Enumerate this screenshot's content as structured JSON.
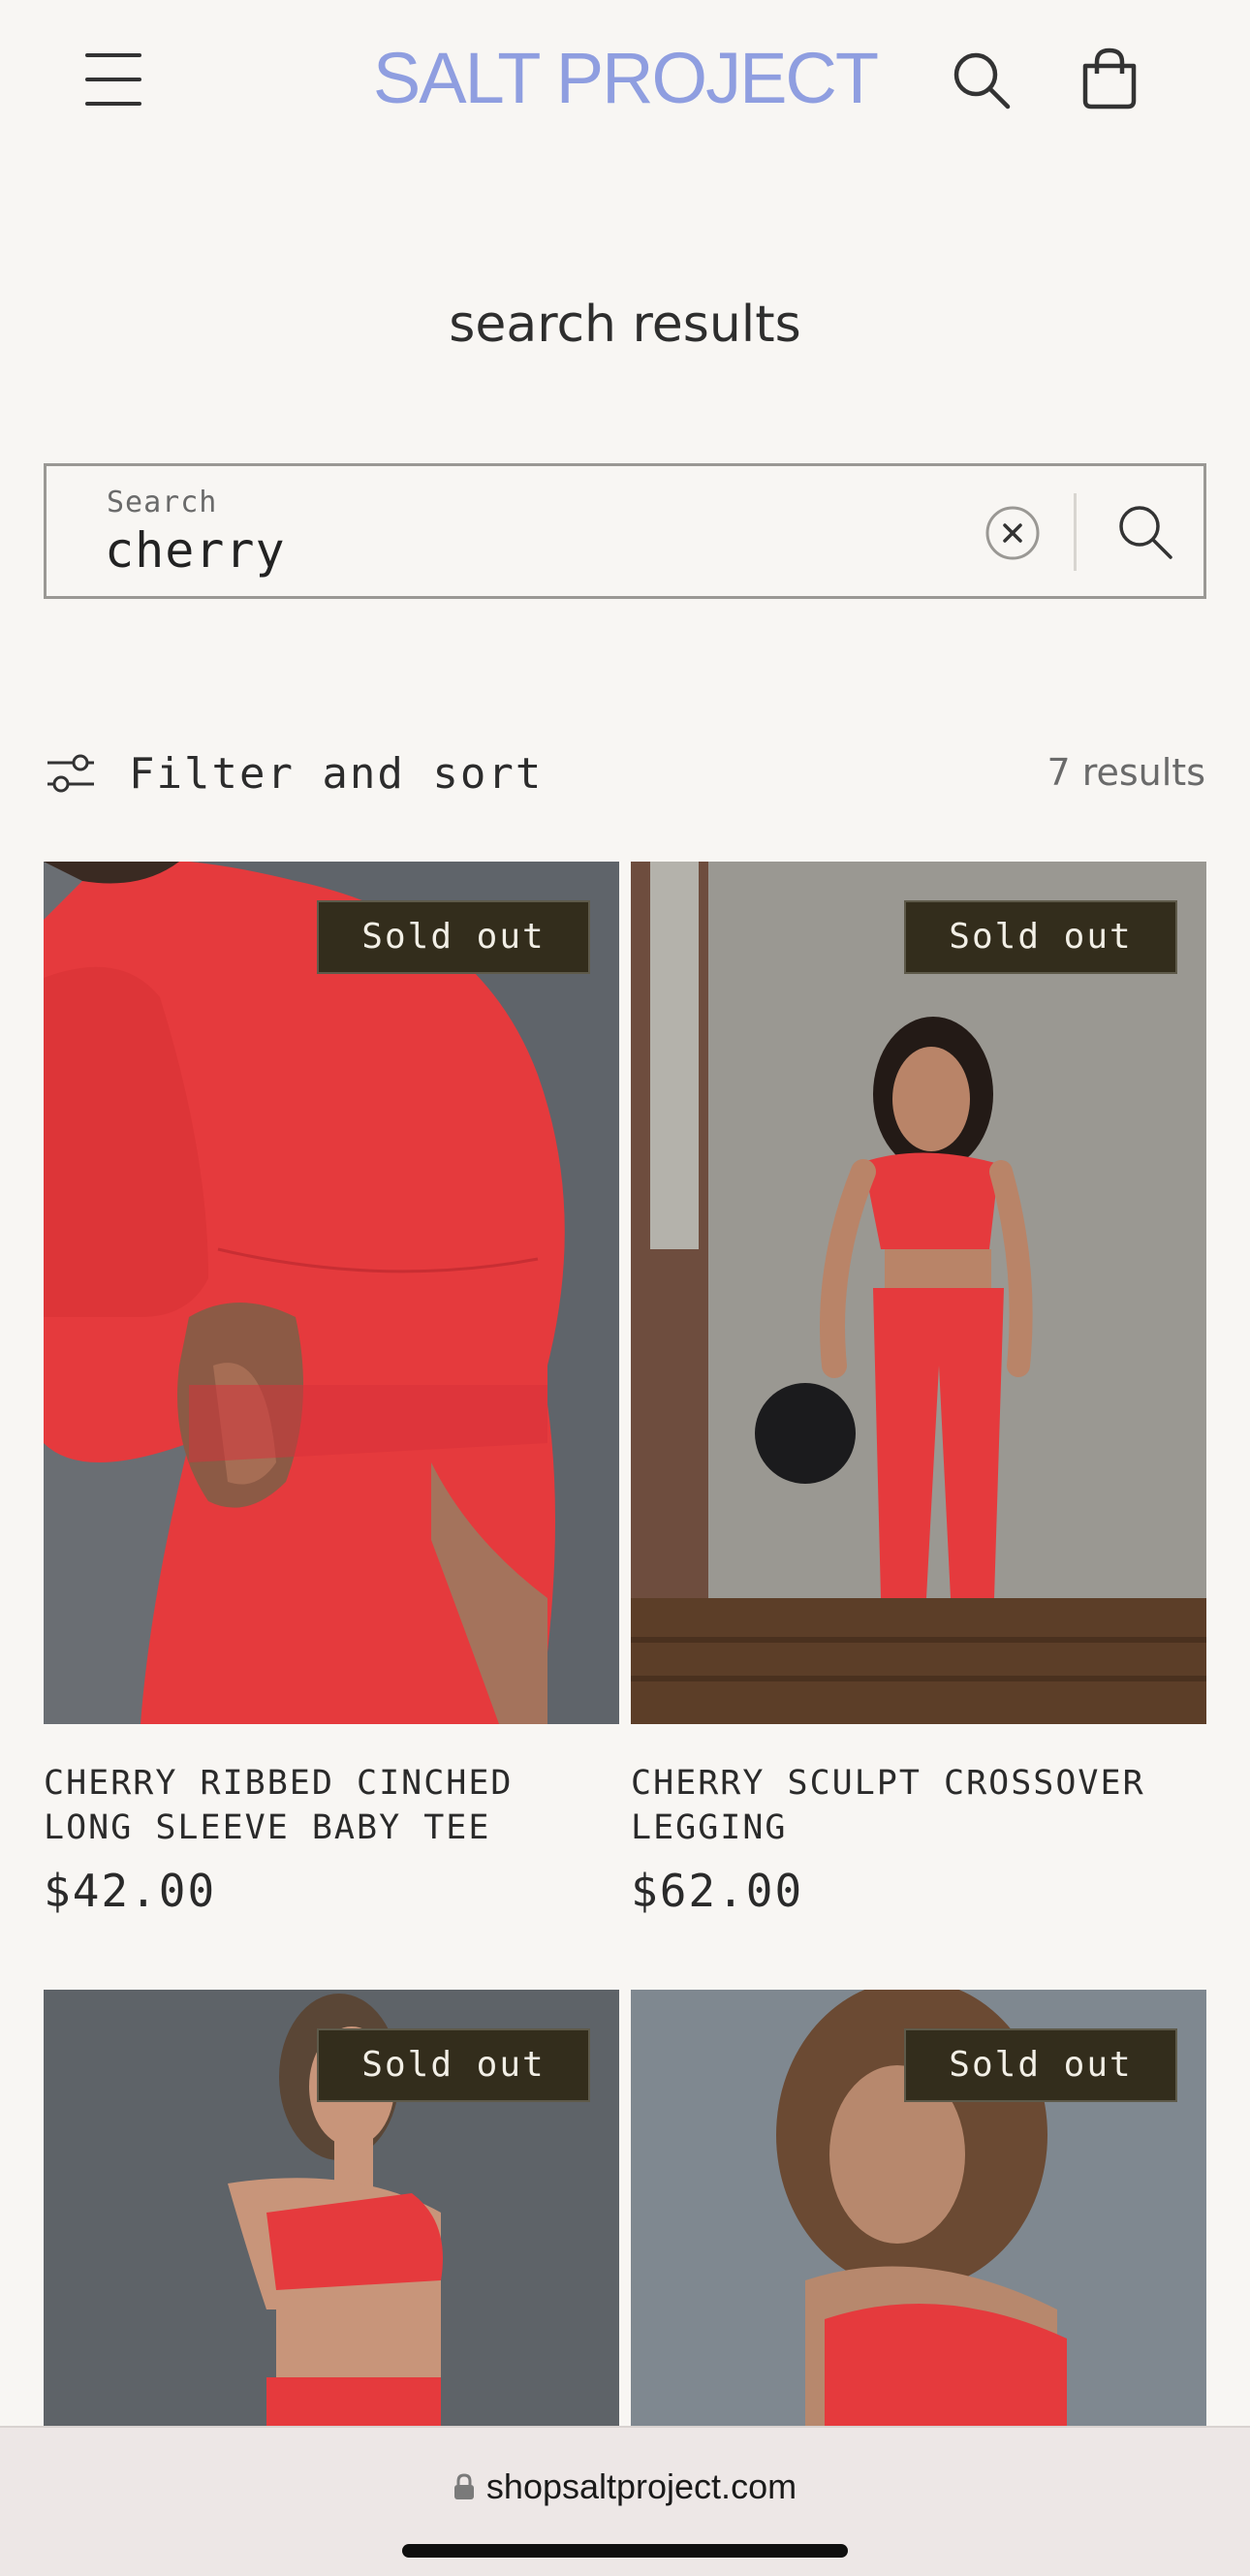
{
  "header": {
    "logo": "SALT PROJECT",
    "menu_icon": "hamburger-menu-icon",
    "search_icon": "search-icon",
    "cart_icon": "shopping-bag-icon",
    "logo_color": "#8f9ee0"
  },
  "page_title": "search results",
  "search": {
    "label": "Search",
    "value": "cherry",
    "clear_icon": "clear-circle-x-icon",
    "submit_icon": "search-icon"
  },
  "filter": {
    "label": "Filter and sort",
    "icon": "sliders-icon",
    "result_count": "7 results"
  },
  "products": [
    {
      "name": "CHERRY RIBBED CINCHED LONG SLEEVE BABY TEE",
      "price": "$42.00",
      "badge": "Sold out"
    },
    {
      "name": "CHERRY SCULPT CROSSOVER LEGGING",
      "price": "$62.00",
      "badge": "Sold out"
    },
    {
      "name": "",
      "price": "",
      "badge": "Sold out"
    },
    {
      "name": "",
      "price": "",
      "badge": "Sold out"
    }
  ],
  "browser": {
    "url": "shopsaltproject.com",
    "lock_icon": "lock-icon"
  },
  "colors": {
    "background": "#f8f6f3",
    "badge_bg": "#332d1c",
    "product_red": "#e6393e"
  }
}
